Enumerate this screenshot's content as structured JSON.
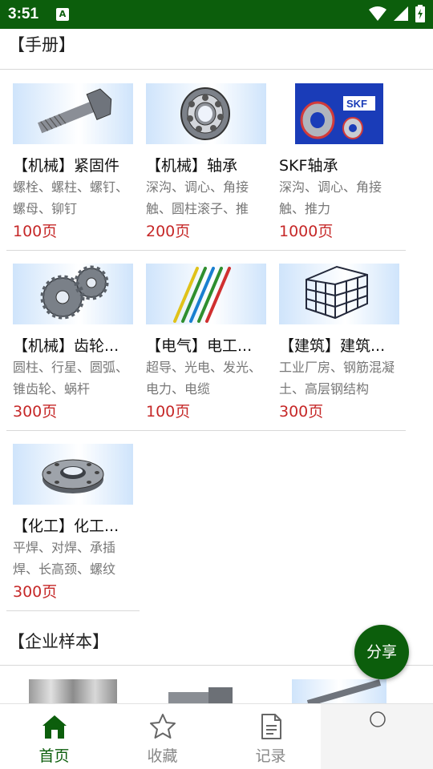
{
  "status_bar": {
    "time": "3:51",
    "notification_icon": "a-icon",
    "icons": [
      "wifi-icon",
      "signal-icon",
      "battery-icon"
    ]
  },
  "sections": {
    "manuals": {
      "title": "【手册】",
      "items": [
        {
          "title": "【机械】紧固件",
          "desc": "螺栓、螺柱、螺钉、螺母、铆钉",
          "pages": "100页",
          "image": "bolt-icon"
        },
        {
          "title": "【机械】轴承",
          "desc": "深沟、调心、角接触、圆柱滚子、推",
          "pages": "200页",
          "image": "bearing-icon"
        },
        {
          "title": "SKF轴承",
          "desc": "深沟、调心、角接触、推力",
          "pages": "1000页",
          "image": "skf-bearing-icon"
        },
        {
          "title": "【机械】齿轮...",
          "desc": "圆柱、行星、圆弧、锥齿轮、蜗杆",
          "pages": "300页",
          "image": "gears-icon"
        },
        {
          "title": "【电气】电工...",
          "desc": "超导、光电、发光、电力、电缆",
          "pages": "100页",
          "image": "wires-icon"
        },
        {
          "title": "【建筑】建筑...",
          "desc": "工业厂房、钢筋混凝土、高层钢结构",
          "pages": "300页",
          "image": "building-icon"
        },
        {
          "title": "【化工】化工...",
          "desc": "平焊、对焊、承插焊、长高颈、螺纹",
          "pages": "300页",
          "image": "flange-icon"
        }
      ]
    },
    "samples": {
      "title": "【企业样本】"
    }
  },
  "share_button": "分享",
  "bottom_nav": [
    {
      "label": "首页",
      "icon": "home-icon",
      "active": true
    },
    {
      "label": "收藏",
      "icon": "star-icon",
      "active": false
    },
    {
      "label": "记录",
      "icon": "document-icon",
      "active": false
    }
  ],
  "colors": {
    "primary": "#0c5e0c",
    "price": "#c62828"
  }
}
